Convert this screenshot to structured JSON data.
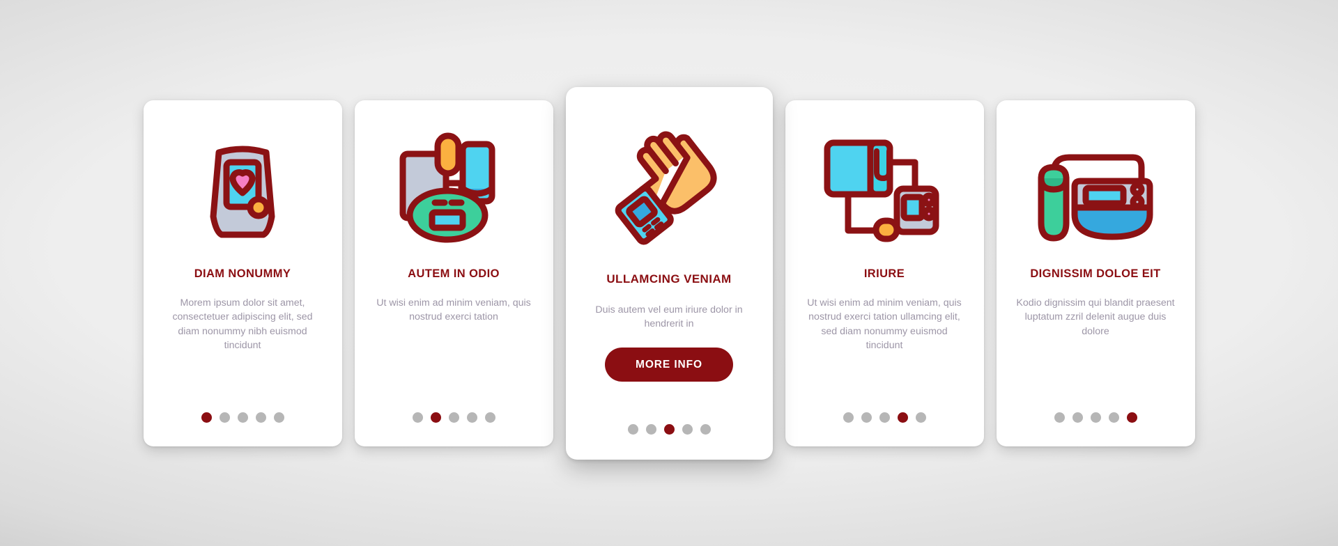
{
  "page": {
    "title": "Medical Devices Onboarding Screens",
    "background_color": "#e8e8e8",
    "accent_color": "#8B0E12",
    "body_text_color": "#9d96a7",
    "dot_inactive_color": "#b6b6b6",
    "dot_count": 5
  },
  "cards": [
    {
      "icon_name": "heart-rate-monitor-icon",
      "title": "DIAM NONUMMY",
      "body": "Morem ipsum dolor sit amet, consectetuer adipiscing elit, sed diam nonummy nibh euismod tincidunt",
      "active_dot": 1,
      "featured": false,
      "button_label": null
    },
    {
      "icon_name": "blood-pressure-cuff-icon",
      "title": "AUTEM IN ODIO",
      "body": "Ut wisi enim ad minim veniam, quis nostrud exerci tation",
      "active_dot": 2,
      "featured": false,
      "button_label": null
    },
    {
      "icon_name": "wrist-blood-pressure-monitor-icon",
      "title": "ULLAMCING VENIAM",
      "body": "Duis autem vel eum iriure dolor in hendrerit in",
      "active_dot": 3,
      "featured": true,
      "button_label": "MORE INFO"
    },
    {
      "icon_name": "sphygmomanometer-icon",
      "title": "IRIURE",
      "body": "Ut wisi enim ad minim veniam, quis nostrud exerci tation ullamcing elit, sed diam nonummy euismod tincidunt",
      "active_dot": 4,
      "featured": false,
      "button_label": null
    },
    {
      "icon_name": "digital-blood-pressure-device-icon",
      "title": "DIGNISSIM DOLOE EIT",
      "body": "Kodio dignissim qui blandit praesent luptatum zzril delenit augue duis dolore",
      "active_dot": 5,
      "featured": false,
      "button_label": null
    }
  ],
  "icon_palette": {
    "outline": "#8B1214",
    "cyan": "#4FD3F0",
    "teal": "#3DCF9B",
    "orange": "#FBB040",
    "pink": "#F77FC4",
    "slate": "#C3CAD9",
    "skin": "#FBBF69",
    "blue": "#35A8DE"
  }
}
